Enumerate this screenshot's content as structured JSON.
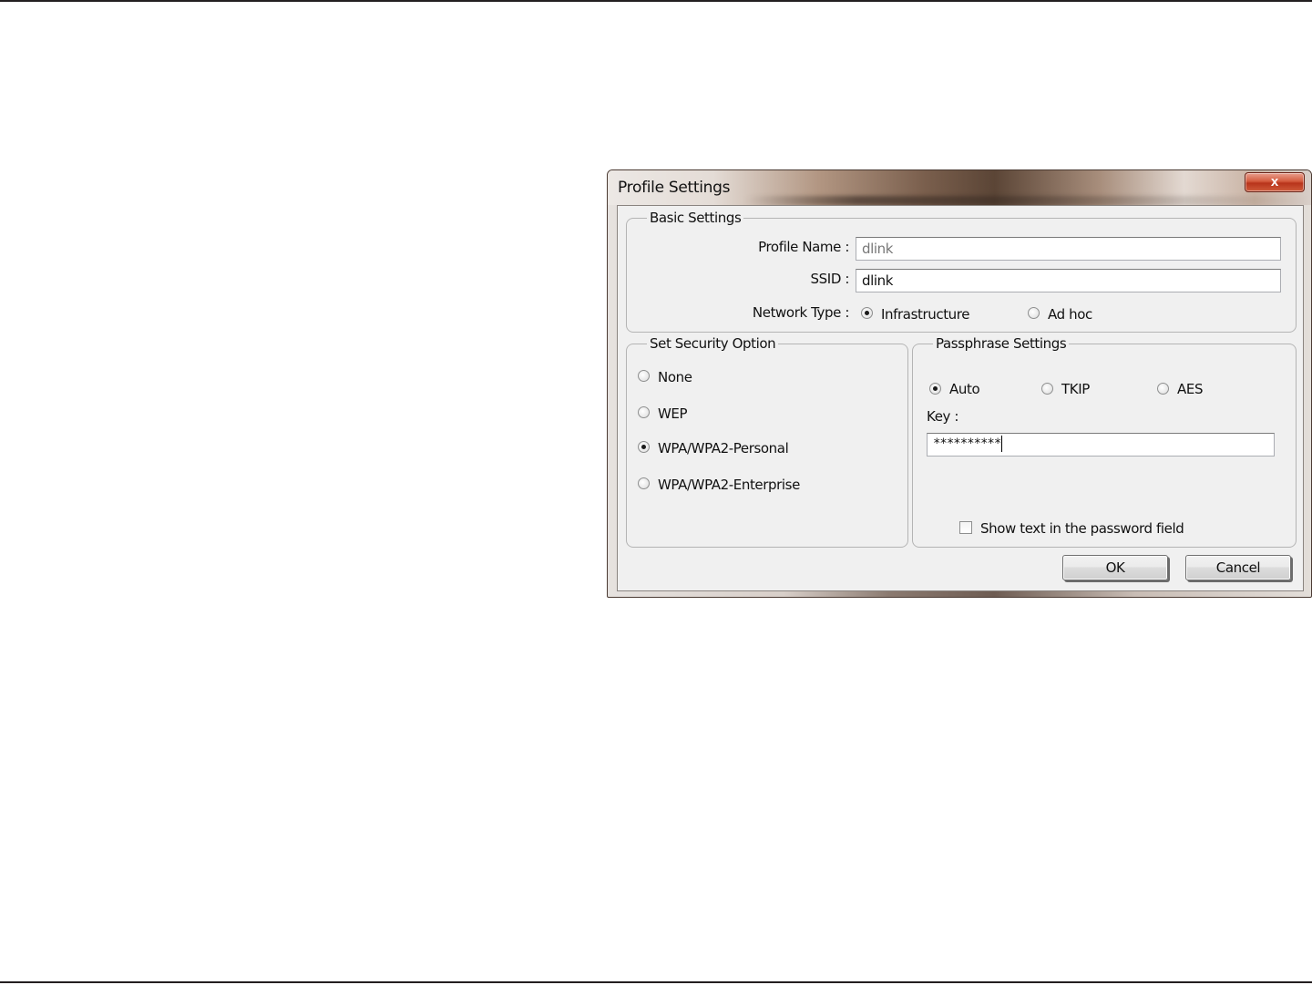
{
  "window": {
    "title": "Profile Settings",
    "close_symbol": "x"
  },
  "basic_settings": {
    "legend": "Basic Settings",
    "profile_name_label": "Profile Name :",
    "profile_name_value": "dlink",
    "ssid_label": "SSID :",
    "ssid_value": "dlink",
    "network_type_label": "Network Type :",
    "network_type_options": [
      "Infrastructure",
      "Ad hoc"
    ],
    "network_type_selected": "Infrastructure"
  },
  "security": {
    "legend": "Set Security Option",
    "options": [
      "None",
      "WEP",
      "WPA/WPA2-Personal",
      "WPA/WPA2-Enterprise"
    ],
    "selected": "WPA/WPA2-Personal"
  },
  "passphrase": {
    "legend": "Passphrase Settings",
    "cipher_options": [
      "Auto",
      "TKIP",
      "AES"
    ],
    "cipher_selected": "Auto",
    "key_label": "Key :",
    "key_value": "**********",
    "show_text_label": "Show text in the password field",
    "show_text_checked": false
  },
  "buttons": {
    "ok": "OK",
    "cancel": "Cancel"
  }
}
